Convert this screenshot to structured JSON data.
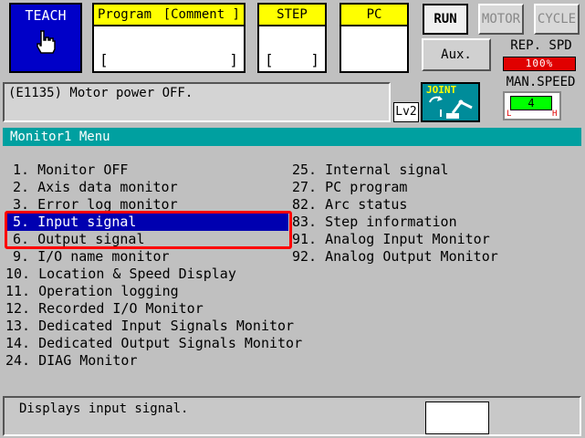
{
  "mode": {
    "label": "TEACH",
    "icon": "hand-pointer-icon"
  },
  "program_panel": {
    "program_label": "Program",
    "comment_label": "[Comment ]",
    "open_bracket": "[",
    "close_bracket": "]"
  },
  "step_panel": {
    "label": "STEP",
    "open_bracket": "[",
    "close_bracket": "]"
  },
  "pc_panel": {
    "label": "PC"
  },
  "buttons": {
    "run": "RUN",
    "motor": "MOTOR",
    "cycle": "CYCLE",
    "aux": "Aux."
  },
  "speed": {
    "rep_label": "REP. SPD",
    "rep_value": "100%",
    "man_label": "MAN.SPEED",
    "man_value": "4",
    "low": "L",
    "high": "H"
  },
  "message": "(E1135) Motor power OFF.",
  "level": "Lv2",
  "joint": {
    "label": "JOINT",
    "icon": "robot-arm-icon"
  },
  "menu": {
    "title": "Monitor1 Menu",
    "left": [
      "1. Monitor OFF",
      "2. Axis data monitor",
      "3. Error log monitor",
      "5. Input signal",
      "6. Output signal",
      "9. I/O name monitor",
      "10. Location & Speed Display",
      "11. Operation logging",
      "12. Recorded I/O Monitor",
      "13. Dedicated Input Signals Monitor",
      "14. Dedicated Output Signals Monitor",
      "24. DIAG Monitor"
    ],
    "right": [
      "25. Internal signal",
      "27. PC program",
      "82. Arc status",
      "83. Step information",
      "91. Analog Input Monitor",
      "92. Analog Output Monitor"
    ]
  },
  "status_text": "Displays input signal.",
  "colors": {
    "teach_bg": "#0000c8",
    "panel_header": "#ffff00",
    "menu_header": "#00a0a0",
    "selection": "#0000b0",
    "highlight_border": "#ff0000",
    "rep_spd_bg": "#e00000",
    "man_speed_bar": "#00ff00",
    "joint_bg": "#008c9a"
  }
}
